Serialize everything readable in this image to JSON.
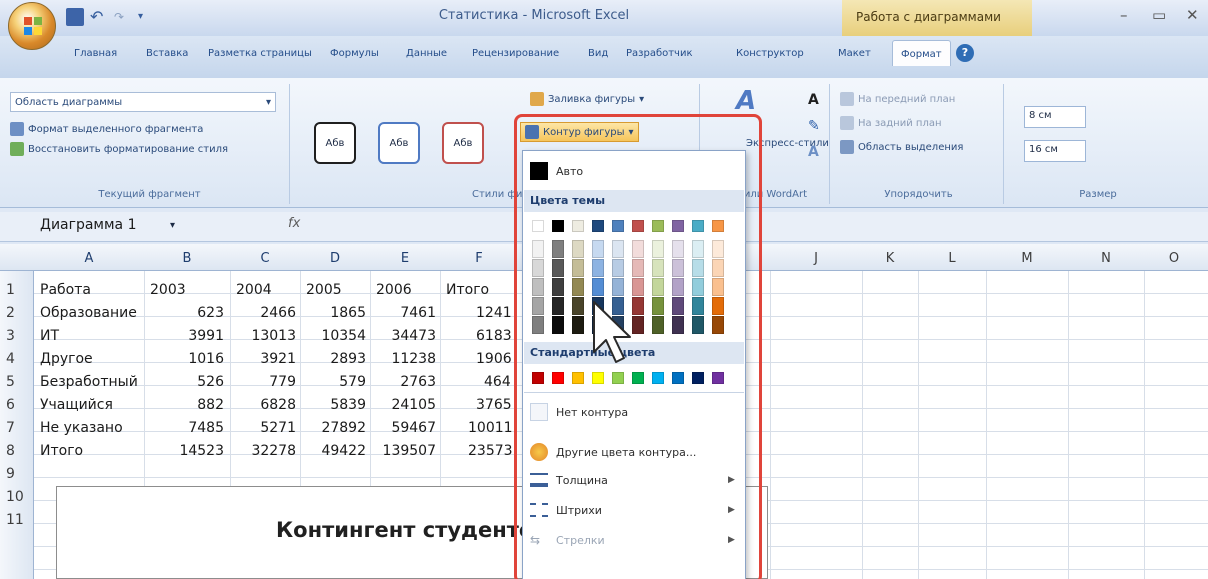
{
  "window": {
    "app_title": "Статистика - Microsoft Excel",
    "context_title": "Работа с диаграммами"
  },
  "ribbon_tabs": [
    "Главная",
    "Вставка",
    "Разметка страницы",
    "Формулы",
    "Данные",
    "Рецензирование",
    "Вид",
    "Разработчик",
    "Конструктор",
    "Макет",
    "Формат"
  ],
  "groups": {
    "current": {
      "select_value": "Область диаграммы",
      "format_sel": "Формат выделенного фрагмента",
      "reset_style": "Восстановить форматирование стиля",
      "label": "Текущий фрагмент"
    },
    "shape_styles": {
      "abe": [
        "Абв",
        "Абв",
        "Абв"
      ],
      "fill": "Заливка фигуры",
      "outline": "Контур фигуры",
      "label": "Стили фигур"
    },
    "wordart": {
      "quick": "Экспресс-стили",
      "label": "Стили WordArt"
    },
    "arrange": {
      "front": "На передний план",
      "back": "На задний план",
      "pane": "Область выделения",
      "label": "Упорядочить"
    },
    "size": {
      "height": "8 см",
      "width": "16 см",
      "label": "Размер"
    }
  },
  "formula_bar": {
    "name_box": "Диаграмма 1",
    "fx": "fx"
  },
  "sheet": {
    "columns": [
      "A",
      "B",
      "C",
      "D",
      "E",
      "F",
      "J",
      "K",
      "L",
      "M",
      "N",
      "O"
    ],
    "rows": [
      "1",
      "2",
      "3",
      "4",
      "5",
      "6",
      "7",
      "8",
      "9",
      "10",
      "11"
    ],
    "header": [
      "Работа",
      "2003",
      "2004",
      "2005",
      "2006",
      "Итого"
    ],
    "data": [
      [
        "Образование",
        "623",
        "2466",
        "1865",
        "7461",
        "1241"
      ],
      [
        "ИТ",
        "3991",
        "13013",
        "10354",
        "34473",
        "6183"
      ],
      [
        "Другое",
        "1016",
        "3921",
        "2893",
        "11238",
        "1906"
      ],
      [
        "Безработный",
        "526",
        "779",
        "579",
        "2763",
        "464"
      ],
      [
        "Учащийся",
        "882",
        "6828",
        "5839",
        "24105",
        "3765"
      ],
      [
        "Не указано",
        "7485",
        "5271",
        "27892",
        "59467",
        "10011"
      ],
      [
        "Итого",
        "14523",
        "32278",
        "49422",
        "139507",
        "23573"
      ]
    ]
  },
  "chart": {
    "title": "Контингент студентов"
  },
  "dropdown": {
    "auto": "Авто",
    "theme_colors": "Цвета темы",
    "standard_colors": "Стандартные цвета",
    "no_outline": "Нет контура",
    "more_colors": "Другие цвета контура...",
    "weight": "Толщина",
    "dashes": "Штрихи",
    "arrows": "Стрелки",
    "theme_top": [
      "#ffffff",
      "#000000",
      "#eeece1",
      "#1f497d",
      "#4f81bd",
      "#c0504d",
      "#9bbb59",
      "#8064a2",
      "#4bacc6",
      "#f79646"
    ],
    "theme_shades": [
      [
        "#f2f2f2",
        "#7f7f7f",
        "#ddd9c3",
        "#c6d9f0",
        "#dbe5f1",
        "#f2dcdb",
        "#ebf1dd",
        "#e5e0ec",
        "#dbeef3",
        "#fdeada"
      ],
      [
        "#d8d8d8",
        "#595959",
        "#c4bd97",
        "#8db3e2",
        "#b8cce4",
        "#e5b9b7",
        "#d7e3bc",
        "#ccc1d9",
        "#b7dde8",
        "#fbd5b5"
      ],
      [
        "#bfbfbf",
        "#3f3f3f",
        "#938953",
        "#548dd4",
        "#95b3d7",
        "#d99694",
        "#c3d69b",
        "#b2a2c7",
        "#92cddc",
        "#fac08f"
      ],
      [
        "#a5a5a5",
        "#262626",
        "#494429",
        "#17365d",
        "#366092",
        "#953734",
        "#76923c",
        "#5f497a",
        "#31859b",
        "#e36c09"
      ],
      [
        "#7f7f7f",
        "#0c0c0c",
        "#1d1b10",
        "#0f243e",
        "#244061",
        "#632423",
        "#4f6128",
        "#3f3151",
        "#205867",
        "#974806"
      ]
    ],
    "standard": [
      "#c00000",
      "#ff0000",
      "#ffc000",
      "#ffff00",
      "#92d050",
      "#00b050",
      "#00b0f0",
      "#0070c0",
      "#002060",
      "#7030a0"
    ]
  }
}
